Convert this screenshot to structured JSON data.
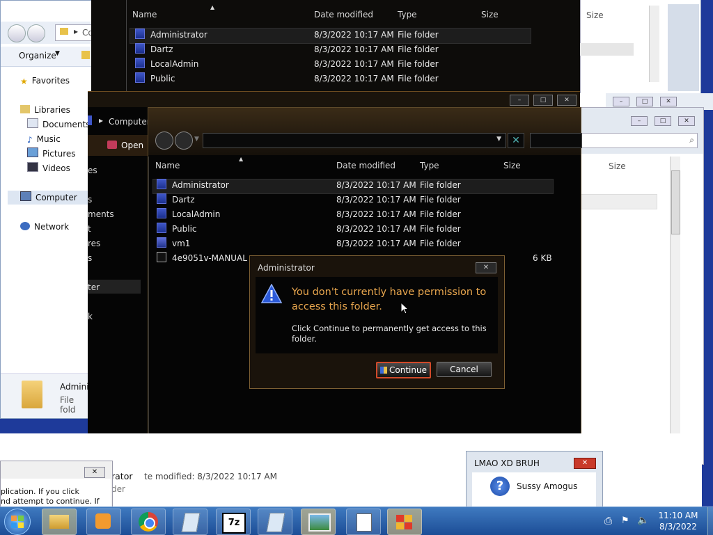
{
  "bg_explorer": {
    "organize": "Organize",
    "crumb": "Co",
    "sidebar": [
      "Favorites",
      "Libraries",
      "Documents",
      "Music",
      "Pictures",
      "Videos",
      "Computer",
      "Network"
    ],
    "detail_name": "Admini",
    "detail_type": "File fold"
  },
  "top_explorer": {
    "columns": [
      "Name",
      "Date modified",
      "Type",
      "Size"
    ],
    "rows": [
      {
        "name": "Administrator",
        "date": "8/3/2022 10:17 AM",
        "type": "File folder"
      },
      {
        "name": "Dartz",
        "date": "8/3/2022 10:17 AM",
        "type": "File folder"
      },
      {
        "name": "LocalAdmin",
        "date": "8/3/2022 10:17 AM",
        "type": "File folder"
      },
      {
        "name": "Public",
        "date": "8/3/2022 10:17 AM",
        "type": "File folder"
      }
    ],
    "size_right": "Size"
  },
  "mid_explorer": {
    "crumb": "Computer",
    "open_label": "Open",
    "side_fragments": [
      "es",
      "s",
      "ments",
      "t",
      "res",
      "s",
      "ter",
      "k"
    ]
  },
  "main_explorer": {
    "columns": [
      "Name",
      "Date modified",
      "Type",
      "Size"
    ],
    "rows": [
      {
        "name": "Administrator",
        "date": "8/3/2022 10:17 AM",
        "type": "File folder",
        "size": ""
      },
      {
        "name": "Dartz",
        "date": "8/3/2022 10:17 AM",
        "type": "File folder",
        "size": ""
      },
      {
        "name": "LocalAdmin",
        "date": "8/3/2022 10:17 AM",
        "type": "File folder",
        "size": ""
      },
      {
        "name": "Public",
        "date": "8/3/2022 10:17 AM",
        "type": "File folder",
        "size": ""
      },
      {
        "name": "vm1",
        "date": "8/3/2022 10:17 AM",
        "type": "File folder",
        "size": ""
      },
      {
        "name": "4e9051v-MANUAL",
        "date": "",
        "type": "",
        "size": "6 KB"
      }
    ],
    "right_size": "Size",
    "status_name": "rator",
    "status_date": "te modified:  8/3/2022 10:17 AM",
    "status_type": "der"
  },
  "dialog": {
    "title": "Administrator",
    "heading": "You don't currently have permission to access this folder.",
    "body": "Click Continue to permanently get access to this folder.",
    "continue_label": "Continue",
    "cancel_label": "Cancel"
  },
  "left_dialog": {
    "line1": "plication. If you click",
    "line2": "nd attempt to continue. If"
  },
  "popup": {
    "title": "LMAO XD BRUH",
    "message": "Sussy Amogus"
  },
  "clock": {
    "time": "11:10 AM",
    "date": "8/3/2022"
  },
  "colors": {
    "dialog_heading": "#e8a64e",
    "dark_frame": "#5e4a2a",
    "taskbar": "#2a5ea8"
  }
}
